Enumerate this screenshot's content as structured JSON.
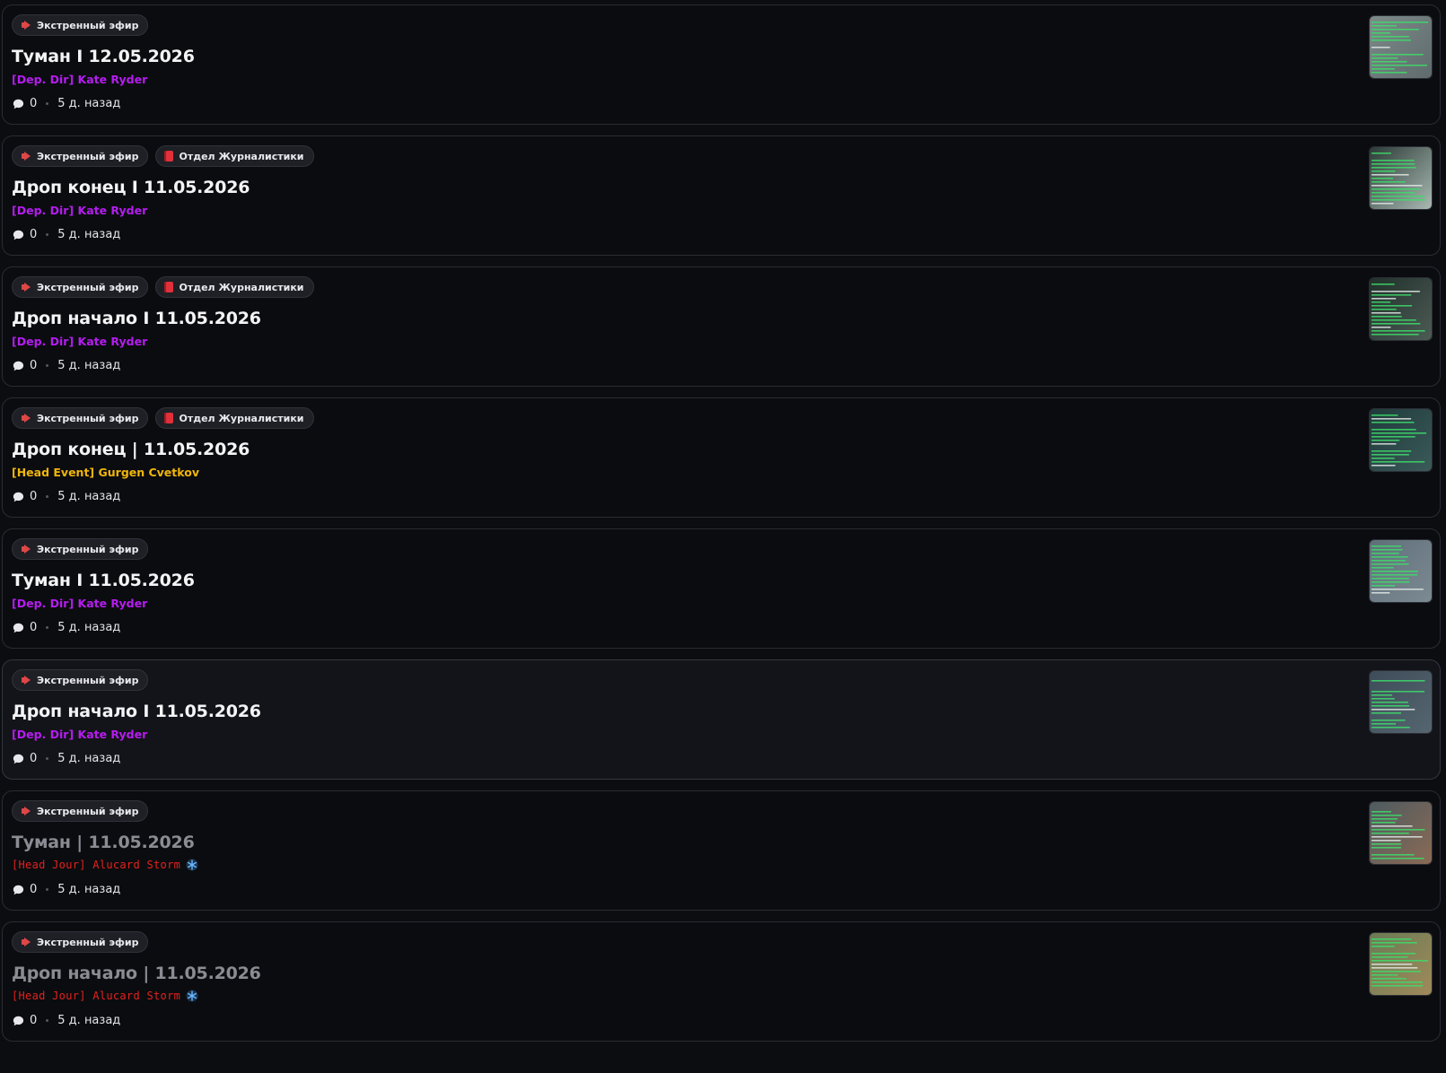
{
  "tag_labels": {
    "emergency": "Экстренный эфир",
    "journalism": "Отдел Журналистики"
  },
  "colors": {
    "director": "#b51cf0",
    "head_event": "#f0b60c",
    "head_jour": "#e3221e",
    "snowflake": "#6ab8ff"
  },
  "posts": [
    {
      "title": "Туман I 12.05.2026",
      "author": "[Dep. Dir] Kate Ryder",
      "author_style": "director",
      "comments": "0",
      "time": "5 д. назад",
      "tags": [
        "emergency"
      ],
      "read": false,
      "thumb_icon": "screenshot-thumbnail"
    },
    {
      "title": "Дроп конец I 11.05.2026",
      "author": "[Dep. Dir] Kate Ryder",
      "author_style": "director",
      "comments": "0",
      "time": "5 д. назад",
      "tags": [
        "emergency",
        "journalism"
      ],
      "read": false,
      "thumb_icon": "screenshot-thumbnail"
    },
    {
      "title": "Дроп начало I 11.05.2026",
      "author": "[Dep. Dir] Kate Ryder",
      "author_style": "director",
      "comments": "0",
      "time": "5 д. назад",
      "tags": [
        "emergency",
        "journalism"
      ],
      "read": false,
      "thumb_icon": "screenshot-thumbnail"
    },
    {
      "title": "Дроп конец | 11.05.2026",
      "author": "[Head Event] Gurgen Cvetkov",
      "author_style": "head_event",
      "comments": "0",
      "time": "5 д. назад",
      "tags": [
        "emergency",
        "journalism"
      ],
      "read": false,
      "thumb_icon": "screenshot-thumbnail"
    },
    {
      "title": "Туман I 11.05.2026",
      "author": "[Dep. Dir] Kate Ryder",
      "author_style": "director",
      "comments": "0",
      "time": "5 д. назад",
      "tags": [
        "emergency"
      ],
      "read": false,
      "thumb_icon": "screenshot-thumbnail"
    },
    {
      "title": "Дроп начало I 11.05.2026",
      "author": "[Dep. Dir] Kate Ryder",
      "author_style": "director",
      "comments": "0",
      "time": "5 д. назад",
      "tags": [
        "emergency"
      ],
      "read": false,
      "hovered": true,
      "thumb_icon": "screenshot-thumbnail"
    },
    {
      "title": "Туман | 11.05.2026",
      "author": "[Head Jour] Alucard Storm",
      "author_style": "head_jour",
      "snowflake": true,
      "comments": "0",
      "time": "5 д. назад",
      "tags": [
        "emergency"
      ],
      "read": true,
      "thumb_icon": "screenshot-thumbnail"
    },
    {
      "title": "Дроп начало | 11.05.2026",
      "author": "[Head Jour] Alucard Storm",
      "author_style": "head_jour",
      "snowflake": true,
      "comments": "0",
      "time": "5 д. назад",
      "tags": [
        "emergency"
      ],
      "read": true,
      "thumb_icon": "screenshot-thumbnail"
    }
  ]
}
